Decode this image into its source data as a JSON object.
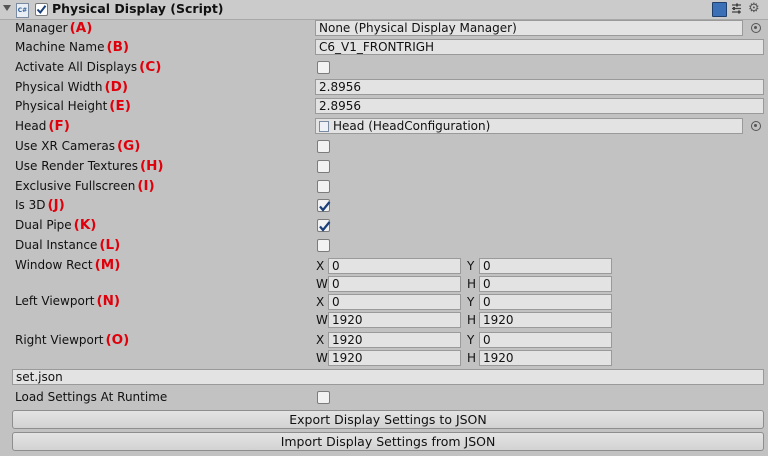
{
  "component": {
    "title": "Physical Display (Script)",
    "enabled": true,
    "script_icon_text": "C#"
  },
  "fields": {
    "manager": {
      "label": "Manager",
      "letter": "(A)",
      "value": "None (Physical Display Manager)"
    },
    "machine_name": {
      "label": "Machine Name",
      "letter": "(B)",
      "value": "C6_V1_FRONTRIGH"
    },
    "activate_all_displays": {
      "label": "Activate All Displays",
      "letter": "(C)",
      "checked": false
    },
    "physical_width": {
      "label": "Physical Width",
      "letter": "(D)",
      "value": "2.8956"
    },
    "physical_height": {
      "label": "Physical Height",
      "letter": "(E)",
      "value": "2.8956"
    },
    "head": {
      "label": "Head",
      "letter": "(F)",
      "value": "Head (HeadConfiguration)"
    },
    "use_xr_cameras": {
      "label": "Use XR Cameras",
      "letter": "(G)",
      "checked": false
    },
    "use_render_textures": {
      "label": "Use Render Textures",
      "letter": "(H)",
      "checked": false
    },
    "exclusive_fullscreen": {
      "label": "Exclusive Fullscreen",
      "letter": "(I)",
      "checked": false
    },
    "is_3d": {
      "label": "Is 3D",
      "letter": "(J)",
      "checked": true
    },
    "dual_pipe": {
      "label": "Dual Pipe",
      "letter": "(K)",
      "checked": true
    },
    "dual_instance": {
      "label": "Dual Instance",
      "letter": "(L)",
      "checked": false
    },
    "window_rect": {
      "label": "Window Rect",
      "letter": "(M)",
      "x": "0",
      "y": "0",
      "w": "0",
      "h": "0"
    },
    "left_viewport": {
      "label": "Left Viewport",
      "letter": "(N)",
      "x": "0",
      "y": "0",
      "w": "1920",
      "h": "1920"
    },
    "right_viewport": {
      "label": "Right Viewport",
      "letter": "(O)",
      "x": "1920",
      "y": "0",
      "w": "1920",
      "h": "1920"
    }
  },
  "rect_labels": {
    "x": "X",
    "y": "Y",
    "w": "W",
    "h": "H"
  },
  "settings_file": "set.json",
  "load_settings_at_runtime": {
    "label": "Load Settings At Runtime",
    "checked": false
  },
  "buttons": {
    "export": "Export Display Settings to JSON",
    "import": "Import Display Settings from JSON"
  },
  "icons": {
    "fold": "triangle-down-icon",
    "help": "book-icon",
    "preset": "sliders-icon",
    "settings": "gear-icon",
    "object_picker": "target-icon"
  }
}
